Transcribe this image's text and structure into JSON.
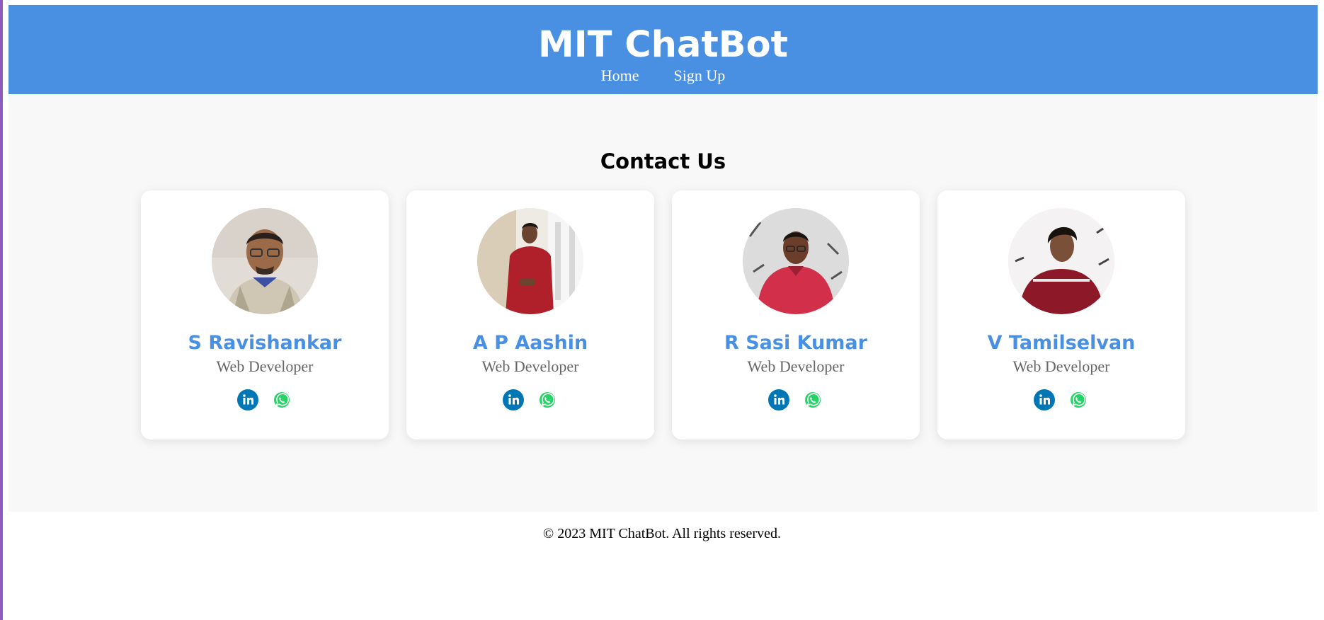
{
  "site": {
    "title": "MIT ChatBot",
    "nav": [
      {
        "label": "Home"
      },
      {
        "label": "Sign Up"
      }
    ]
  },
  "contact": {
    "heading": "Contact Us",
    "members": [
      {
        "name": "S Ravishankar",
        "role": "Web Developer",
        "photo": "person-photo-checked-shirt-glasses"
      },
      {
        "name": "A P Aashin",
        "role": "Web Developer",
        "photo": "person-photo-red-shirt-indoors"
      },
      {
        "name": "R Sasi Kumar",
        "role": "Web Developer",
        "photo": "person-photo-red-shirt-art-wall"
      },
      {
        "name": "V Tamilselvan",
        "role": "Web Developer",
        "photo": "person-photo-maroon-shirt-art-wall"
      }
    ],
    "social_icons": [
      "linkedin-icon",
      "whatsapp-icon"
    ]
  },
  "footer": {
    "text": "© 2023 MIT ChatBot. All rights reserved."
  },
  "colors": {
    "brand": "#4a90e2",
    "linkedin": "#0077b5",
    "whatsapp": "#25d366",
    "page_bg": "#f8f8f8"
  }
}
